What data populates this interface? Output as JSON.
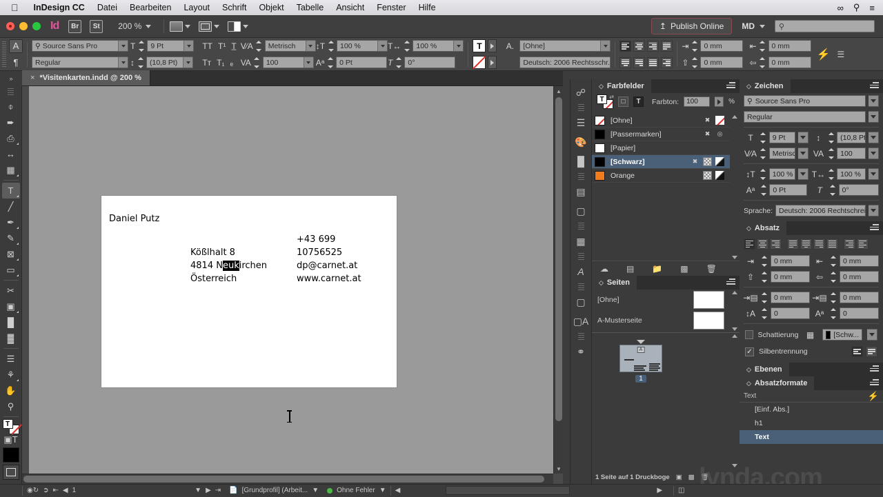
{
  "menubar": {
    "apple_icon": "apple-icon",
    "app_name": "InDesign CC",
    "items": [
      "Datei",
      "Bearbeiten",
      "Layout",
      "Schrift",
      "Objekt",
      "Tabelle",
      "Ansicht",
      "Fenster",
      "Hilfe"
    ],
    "status_icons": [
      "infinity-icon",
      "search-icon",
      "menu-icon"
    ]
  },
  "appbar": {
    "logo": "Id",
    "bridge_label": "Br",
    "stock_label": "St",
    "zoom_level": "200 %",
    "publish_online": "Publish Online",
    "workspace": "MD",
    "search_placeholder": ""
  },
  "control_panel": {
    "mode_char": "A",
    "mode_para": "¶",
    "font_family": "Source Sans Pro",
    "font_style": "Regular",
    "font_size": "9 Pt",
    "leading": "(10,8 Pt)",
    "kerning": "Metrisch",
    "tracking": "100",
    "vertical_scale": "100 %",
    "horizontal_scale": "100 %",
    "baseline_shift": "0 Pt",
    "skew": "0°",
    "character_style": "[Ohne]",
    "language": "Deutsch: 2006 Rechtsschr...",
    "indent_left": "0 mm",
    "indent_right": "0 mm",
    "indent_first": "0 mm",
    "indent_last": "0 mm"
  },
  "document_tab": {
    "close": "×",
    "title": "*Visitenkarten.indd @ 200 %"
  },
  "toolbox": {
    "tools": [
      {
        "name": "selection-tool",
        "glyph": "⬉"
      },
      {
        "name": "direct-selection-tool",
        "glyph": "⬈"
      },
      {
        "name": "page-tool",
        "glyph": "◳"
      },
      {
        "name": "gap-tool",
        "glyph": "↔"
      },
      {
        "name": "content-collector-tool",
        "glyph": "⛁"
      },
      {
        "name": "type-tool",
        "glyph": "T"
      },
      {
        "name": "line-tool",
        "glyph": "╱"
      },
      {
        "name": "pen-tool",
        "glyph": "✒"
      },
      {
        "name": "pencil-tool",
        "glyph": "✏"
      },
      {
        "name": "frame-tool",
        "glyph": "⊠"
      },
      {
        "name": "rectangle-tool",
        "glyph": "▭"
      },
      {
        "name": "scissors-tool",
        "glyph": "✂"
      },
      {
        "name": "free-transform-tool",
        "glyph": "⬚"
      },
      {
        "name": "gradient-swatch-tool",
        "glyph": "▤"
      },
      {
        "name": "gradient-feather-tool",
        "glyph": "▨"
      },
      {
        "name": "note-tool",
        "glyph": "▤"
      },
      {
        "name": "eyedropper-tool",
        "glyph": "⚲"
      },
      {
        "name": "hand-tool",
        "glyph": "✋"
      },
      {
        "name": "zoom-tool",
        "glyph": "🔍"
      }
    ]
  },
  "canvas": {
    "card": {
      "name": "Daniel Putz",
      "address_lines": [
        "Kößlhalt 8",
        "4814 N",
        "Österreich"
      ],
      "address_selected": "euk",
      "address_after_selection": "irchen",
      "contact_lines": [
        "+43 699",
        "10756525",
        "dp@carnet.at",
        "www.carnet.at"
      ]
    }
  },
  "swatches_panel": {
    "title": "Farbfelder",
    "tint_label": "Farbton:",
    "tint_value": "100",
    "tint_unit": "%",
    "rows": [
      {
        "name": "[Ohne]",
        "color": "none",
        "selected": false
      },
      {
        "name": "[Passermarken]",
        "color": "#000000",
        "selected": false
      },
      {
        "name": "[Papier]",
        "color": "#ffffff",
        "selected": false
      },
      {
        "name": "[Schwarz]",
        "color": "#000000",
        "selected": true
      },
      {
        "name": "Orange",
        "color": "#f07c1e",
        "selected": false
      }
    ]
  },
  "pages_panel": {
    "title": "Seiten",
    "masters": [
      "[Ohne]",
      "A-Musterseite"
    ],
    "page_letter": "A",
    "page_number": "1",
    "status": "1 Seite auf 1 Druckboge"
  },
  "character_panel": {
    "title": "Zeichen",
    "font_family": "Source Sans Pro",
    "font_style": "Regular",
    "font_size": "9 Pt",
    "leading": "(10,8 Pt)",
    "kerning": "Metrisch",
    "tracking": "100",
    "vertical_scale": "100 %",
    "horizontal_scale": "100 %",
    "baseline_shift": "0 Pt",
    "skew": "0°",
    "language_label": "Sprache:",
    "language": "Deutsch: 2006 Rechtschreib..."
  },
  "paragraph_panel": {
    "title": "Absatz",
    "indent_left": "0 mm",
    "indent_right": "0 mm",
    "indent_first": "0 mm",
    "indent_last": "0 mm",
    "space_before": "0 mm",
    "space_after": "0 mm",
    "drop_cap_lines": "0",
    "drop_cap_chars": "0",
    "shading_label": "Schattierung",
    "shading_color": "[Schw...",
    "hyphenation_label": "Silbentrennung"
  },
  "layers_panel": {
    "title": "Ebenen"
  },
  "paragraph_styles_panel": {
    "title": "Absatzformate",
    "current": "Text",
    "styles": [
      {
        "name": "[Einf. Abs.]",
        "selected": false
      },
      {
        "name": "h1",
        "selected": false
      },
      {
        "name": "Text",
        "selected": true
      }
    ]
  },
  "statusbar": {
    "page_number": "1",
    "preflight_profile": "[Grundprofil] (Arbeit...",
    "errors": "Ohne Fehler"
  },
  "watermark": "lynda.com",
  "colors": {
    "panel_bg": "#3b3b3b",
    "selection_blue": "#4a6079",
    "accent_orange": "#f07c1e",
    "publish_border": "#8a4a52"
  }
}
